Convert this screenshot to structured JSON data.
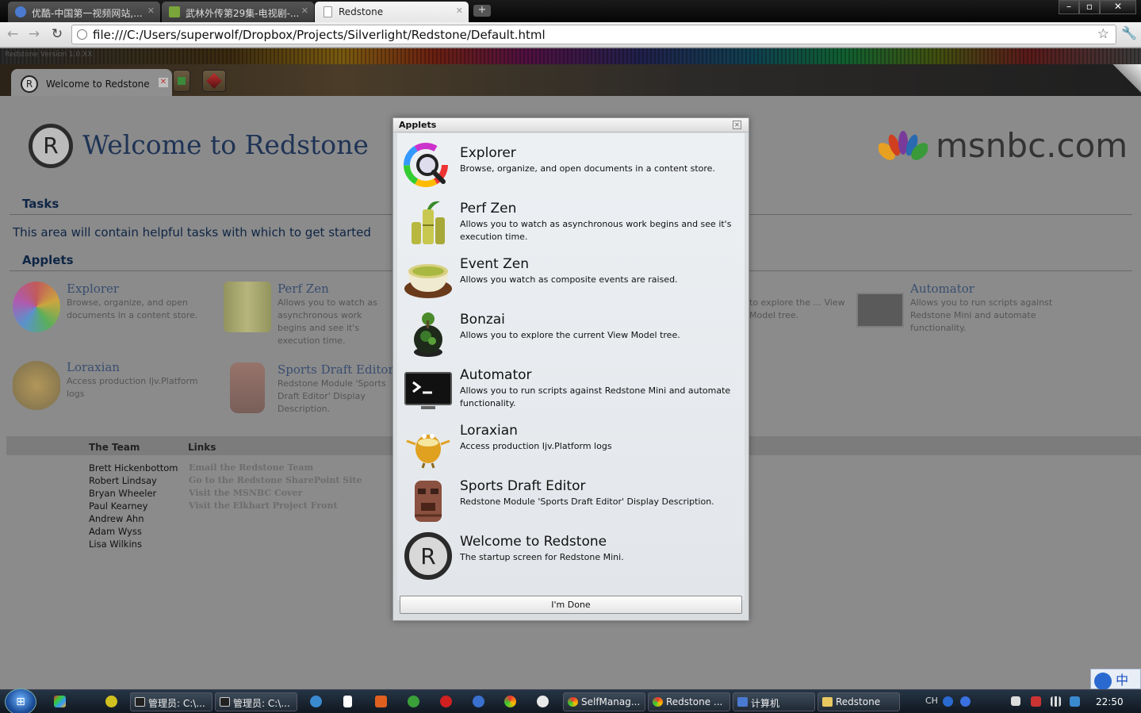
{
  "browser": {
    "tabs": [
      {
        "label": "优酷-中国第一视频网站,...",
        "icon_color": "#4a7bd0"
      },
      {
        "label": "武林外传第29集-电视剧-...",
        "icon_color": "#7aa53a"
      },
      {
        "label": "Redstone",
        "icon_color": "#ffffff"
      }
    ],
    "new_tab": "+",
    "window_controls": {
      "minimize": "–",
      "maximize": "▫",
      "close": "✕"
    },
    "url": "file:///C:/Users/superwolf/Dropbox/Projects/Silverlight/Redstone/Default.html",
    "nav_icons": {
      "back": "←",
      "forward": "→",
      "reload": "↻",
      "star": "☆",
      "wrench": "🔧"
    }
  },
  "app": {
    "version": "Redstone Version 1.0.XX",
    "tab_label": "Welcome to Redstone",
    "tab_logo": "R",
    "tab_close": "✕"
  },
  "page": {
    "logo_letter": "R",
    "title": "Welcome to Redstone",
    "brand": "msnbc.com",
    "tasks_heading": "Tasks",
    "tasks_text": "This area will contain helpful tasks with which to get started",
    "applets_heading": "Applets",
    "applets": [
      {
        "title": "Explorer",
        "desc": "Browse, organize, and open documents in a content store."
      },
      {
        "title": "Perf Zen",
        "desc": "Allows you to watch as asynchronous work begins and see it's execution time."
      },
      {
        "title": "",
        "desc": "to explore the ... View Model tree."
      },
      {
        "title": "Automator",
        "desc": "Allows you to run scripts against Redstone Mini and automate functionality."
      },
      {
        "title": "Loraxian",
        "desc": "Access production Ijv.Platform logs"
      },
      {
        "title": "Sports Draft Editor",
        "desc": "Redstone Module 'Sports Draft Editor' Display Description."
      }
    ],
    "team_heading": "The Team",
    "links_heading": "Links",
    "team": [
      "Brett Hickenbottom",
      "Robert Lindsay",
      "Bryan Wheeler",
      "Paul Kearney",
      "Andrew Ahn",
      "Adam Wyss",
      "Lisa Wilkins"
    ],
    "links": [
      "Email the Redstone Team",
      "Go to the Redstone SharePoint Site",
      "Visit the MSNBC Cover",
      "Visit the Elkhart Project Front"
    ]
  },
  "dialog": {
    "title": "Applets",
    "close": "✕",
    "items": [
      {
        "title": "Explorer",
        "desc": "Browse, organize, and open documents in a content store.",
        "icon": "explorer-icon"
      },
      {
        "title": "Perf Zen",
        "desc": "Allows you to watch as asynchronous work begins and see it's execution time.",
        "icon": "bamboo-icon"
      },
      {
        "title": "Event Zen",
        "desc": "Allows you watch as composite events are raised.",
        "icon": "tea-cup-icon"
      },
      {
        "title": "Bonzai",
        "desc": "Allows you to explore the current View Model tree.",
        "icon": "bonsai-icon"
      },
      {
        "title": "Automator",
        "desc": "Allows you to run scripts against Redstone Mini and automate functionality.",
        "icon": "terminal-icon"
      },
      {
        "title": "Loraxian",
        "desc": "Access production Ijv.Platform logs",
        "icon": "lorax-icon"
      },
      {
        "title": "Sports Draft Editor",
        "desc": "Redstone Module 'Sports Draft Editor' Display Description.",
        "icon": "tiki-icon"
      },
      {
        "title": "Welcome to Redstone",
        "desc": "The startup screen for Redstone Mini.",
        "icon": "redstone-logo-icon"
      }
    ],
    "done_label": "I'm Done"
  },
  "taskbar": {
    "start": "⊞",
    "buttons": [
      "管理员: C:\\...",
      "管理员: C:\\...",
      "SelfManag...",
      "Redstone ...",
      "计算机",
      "Redstone"
    ],
    "tray_lang": "CH",
    "ime": "中",
    "clock": "22:50"
  }
}
